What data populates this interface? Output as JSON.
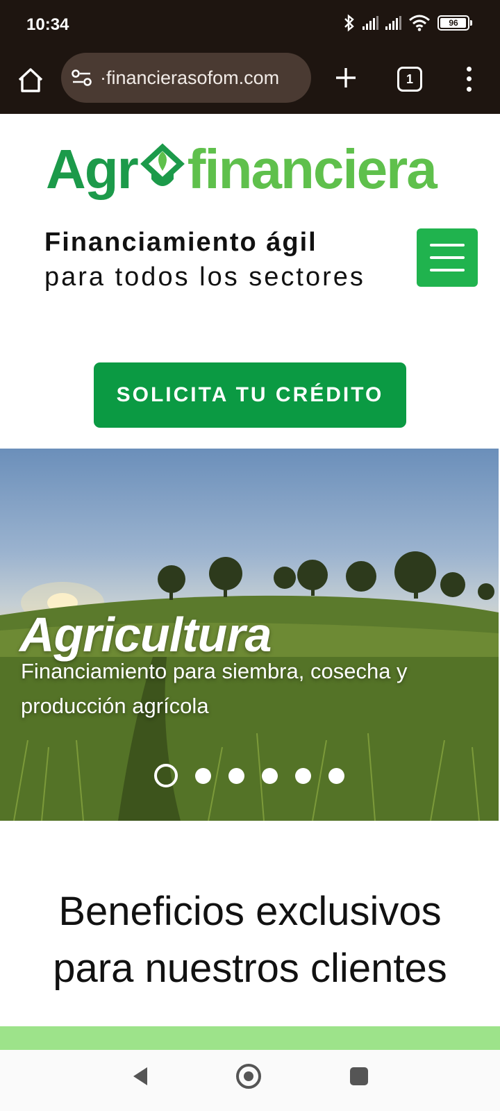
{
  "status": {
    "time": "10:34",
    "battery": "96"
  },
  "browser": {
    "url": "·financierasofom.com",
    "tab_count": "1"
  },
  "brand": {
    "logo_part1": "Agr",
    "logo_part2": "financiera"
  },
  "header": {
    "tagline_bold": "Financiamiento ágil",
    "tagline_regular": "para todos los sectores"
  },
  "cta": {
    "label": "SOLICITA TU CRÉDITO"
  },
  "hero": {
    "title": "Agricultura",
    "subtitle": "Financiamiento para siembra, cosecha y producción agrícola",
    "slide_count": 6,
    "active_slide": 1
  },
  "section": {
    "heading_line1": "Beneficios exclusivos",
    "heading_line2": "para nuestros clientes"
  },
  "colors": {
    "brand_dark": "#1c9a4a",
    "brand_light": "#5fc04c",
    "cta": "#0b9a43",
    "menu": "#20b34e",
    "band": "#9de38a"
  },
  "icons": [
    "home-icon",
    "site-settings-icon",
    "plus-icon",
    "tabs-icon",
    "more-icon",
    "menu-icon",
    "back-icon",
    "home-nav-icon",
    "recents-icon"
  ]
}
